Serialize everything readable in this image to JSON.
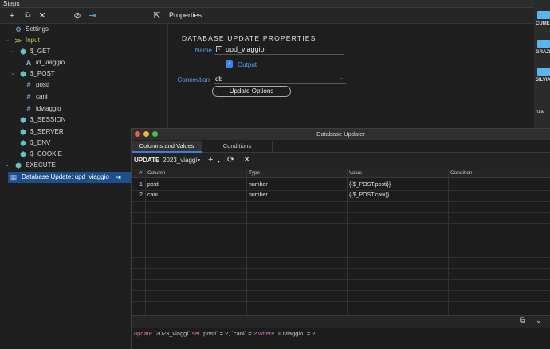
{
  "steps_panel": {
    "title": "Steps",
    "toolbar_icons": [
      "plus-icon",
      "duplicate-icon",
      "close-icon",
      "disable-icon",
      "export-icon"
    ],
    "tree": [
      {
        "label": "Settings",
        "icon": "gear-icon",
        "indent": 1
      },
      {
        "label": "Input",
        "icon": "input-icon",
        "indent": 0,
        "expanded": true
      },
      {
        "label": "$_GET",
        "icon": "cube-icon",
        "indent": 1,
        "expanded": true
      },
      {
        "label": "id_viaggio",
        "icon": "text-type-icon",
        "indent": 2
      },
      {
        "label": "$_POST",
        "icon": "cube-icon",
        "indent": 1,
        "expanded": true
      },
      {
        "label": "posti",
        "icon": "number-type-icon",
        "indent": 2
      },
      {
        "label": "cani",
        "icon": "number-type-icon",
        "indent": 2
      },
      {
        "label": "idviaggio",
        "icon": "number-type-icon",
        "indent": 2
      },
      {
        "label": "$_SESSION",
        "icon": "cube-icon",
        "indent": 1
      },
      {
        "label": "$_SERVER",
        "icon": "cube-icon",
        "indent": 1
      },
      {
        "label": "$_ENV",
        "icon": "cube-icon",
        "indent": 1
      },
      {
        "label": "$_COOKIE",
        "icon": "cube-icon",
        "indent": 1
      },
      {
        "label": "EXECUTE",
        "icon": "cube-icon",
        "indent": 0,
        "expanded": true
      },
      {
        "label": "Database Update: upd_viaggio",
        "icon": "table-icon",
        "indent": 1,
        "selected": true
      }
    ]
  },
  "properties": {
    "header": "Properties",
    "section_title": "DATABASE UPDATE PROPERTIES",
    "name_label": "Name",
    "name_value": "upd_viaggio",
    "output_label": "Output",
    "output_checked": true,
    "connection_label": "Connection",
    "connection_value": "db",
    "update_options_label": "Update Options"
  },
  "right_strip": [
    "CUME",
    "GRAZI",
    "SILVIA",
    "nza"
  ],
  "dialog": {
    "title": "Database Updater",
    "tabs": [
      "Columns and Values",
      "Conditions"
    ],
    "active_tab": 0,
    "update_label": "UPDATE",
    "table": "2023_viaggi",
    "columns": [
      "#",
      "Column",
      "Type",
      "Value",
      "Condition"
    ],
    "rows": [
      {
        "num": "1",
        "column": "posti",
        "type": "number",
        "value": "{{$_POST.posti}}",
        "condition": ""
      },
      {
        "num": "2",
        "column": "cani",
        "type": "number",
        "value": "{{$_POST.cani}}",
        "condition": ""
      }
    ],
    "sql": {
      "kw1": "update",
      "p1": " `2023_viaggi` ",
      "kw2": "set",
      "p2": " `posti` = ?, `cani` = ? ",
      "kw3": "where",
      "p3": " `IDviaggio` = ?"
    }
  },
  "colors": {
    "accent": "#3d7de0",
    "selected": "#1c4f8c",
    "label_blue": "#5aa2f0"
  }
}
